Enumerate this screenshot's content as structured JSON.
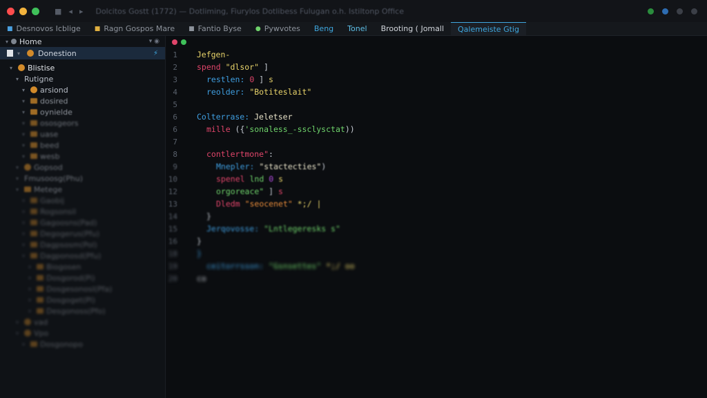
{
  "colors": {
    "accent": "#3fa8e0",
    "folder": "#d18a2a",
    "bg": "#0b0d10"
  },
  "titlebar": {
    "icons": [
      "square-icon",
      "back-icon",
      "forward-icon"
    ],
    "window_title": "Dolcitos Gostt (1772) — Dotliming, Fiurylos Dotlibess Fulugan o.h. Istiltonp Office"
  },
  "tabs": [
    {
      "label": "Desnovos Icblige",
      "icon": "tab-dot-icon"
    },
    {
      "label": "Ragn Gospos Mare",
      "icon": "tab-dot-icon"
    },
    {
      "label": "Fantio Byse",
      "icon": "tab-dot-icon"
    },
    {
      "label": "Pywvotes",
      "icon": "tab-dot-icon"
    },
    {
      "label": "Beng"
    },
    {
      "label": "Tonel"
    },
    {
      "label": "Brooting ( Jomall"
    },
    {
      "label": "Qalemeiste Gtig",
      "active": true
    }
  ],
  "sidebar": {
    "header": "Home",
    "selected": "Donestion",
    "tree": [
      {
        "label": "Blistise",
        "indent": 0,
        "type": "circle",
        "fade": 0
      },
      {
        "label": "Rutigne",
        "indent": 1,
        "type": "none",
        "fade": 0
      },
      {
        "label": "arsiond",
        "indent": 2,
        "type": "circle",
        "fade": 0
      },
      {
        "label": "dosired",
        "indent": 2,
        "type": "folder",
        "fade": 1
      },
      {
        "label": "oynielde",
        "indent": 2,
        "type": "folder",
        "fade": 1
      },
      {
        "label": "ososgeors",
        "indent": 2,
        "type": "folder",
        "fade": 2
      },
      {
        "label": "uase",
        "indent": 2,
        "type": "folder",
        "fade": 2
      },
      {
        "label": "beed",
        "indent": 2,
        "type": "folder",
        "fade": 2
      },
      {
        "label": "wesb",
        "indent": 2,
        "type": "folder",
        "fade": 2
      },
      {
        "label": "Gopsod",
        "indent": 1,
        "type": "circle",
        "fade": 2
      },
      {
        "label": "Fmusoosg(Phu)",
        "indent": 1,
        "type": "none",
        "fade": 2
      },
      {
        "label": "Metege",
        "indent": 1,
        "type": "folder",
        "fade": 2
      },
      {
        "label": "Gaobij",
        "indent": 2,
        "type": "folder",
        "fade": 3
      },
      {
        "label": "Rogsonsil",
        "indent": 2,
        "type": "folder",
        "fade": 3
      },
      {
        "label": "Gagoosns(Pad)",
        "indent": 2,
        "type": "folder",
        "fade": 3
      },
      {
        "label": "Degogerus(Pfu)",
        "indent": 2,
        "type": "folder",
        "fade": 3
      },
      {
        "label": "Dagpsosm(Pol)",
        "indent": 2,
        "type": "folder",
        "fade": 3
      },
      {
        "label": "Dagponosd(Pfu)",
        "indent": 2,
        "type": "folder",
        "fade": 3
      },
      {
        "label": "Biogosen",
        "indent": 3,
        "type": "folder",
        "fade": 3
      },
      {
        "label": "Dosgorod(Pi)",
        "indent": 3,
        "type": "folder",
        "fade": 3
      },
      {
        "label": "Dosgesonosl(Pfa)",
        "indent": 3,
        "type": "folder",
        "fade": 3
      },
      {
        "label": "Dosgoget(Pl)",
        "indent": 3,
        "type": "folder",
        "fade": 3
      },
      {
        "label": "Desgonoss(Pfo)",
        "indent": 3,
        "type": "folder",
        "fade": 3
      },
      {
        "label": "vad",
        "indent": 1,
        "type": "circle",
        "fade": 3
      },
      {
        "label": "Vpo",
        "indent": 1,
        "type": "circle",
        "fade": 3
      },
      {
        "label": "Dosgonopo",
        "indent": 2,
        "type": "folder",
        "fade": 3
      }
    ]
  },
  "code": [
    {
      "n": "1",
      "indent": 0,
      "parts": [
        [
          "p",
          "  "
        ],
        [
          "s",
          "Jefgen-"
        ]
      ]
    },
    {
      "n": "2",
      "indent": 1,
      "parts": [
        [
          "k",
          "spend"
        ],
        [
          "p",
          " "
        ],
        [
          "s",
          "\"dlsor\""
        ],
        [
          "p",
          " ]"
        ]
      ]
    },
    {
      "n": "3",
      "indent": 2,
      "parts": [
        [
          "b",
          "restlen:"
        ],
        [
          "p",
          " "
        ],
        [
          "k",
          "0"
        ],
        [
          "p",
          " ] "
        ],
        [
          "s",
          "s"
        ]
      ]
    },
    {
      "n": "4",
      "indent": 2,
      "parts": [
        [
          "b",
          "reolder:"
        ],
        [
          "p",
          " "
        ],
        [
          "s",
          "\"Botiteslait\""
        ]
      ]
    },
    {
      "n": "5",
      "indent": 0,
      "parts": []
    },
    {
      "n": "6",
      "indent": 1,
      "parts": [
        [
          "b",
          "Colterrase:"
        ],
        [
          "p",
          " "
        ],
        [
          "w",
          "Jeletser"
        ]
      ]
    },
    {
      "n": "6",
      "indent": 2,
      "parts": [
        [
          "k",
          "mille"
        ],
        [
          "p",
          " ({"
        ],
        [
          "v",
          "'sonaless_-ssclysctat"
        ],
        [
          "p",
          "))"
        ]
      ]
    },
    {
      "n": "7",
      "indent": 0,
      "parts": []
    },
    {
      "n": "8",
      "indent": 2,
      "parts": [
        [
          "k",
          "contlertmone\""
        ],
        [
          "p",
          ":"
        ]
      ]
    },
    {
      "n": "9",
      "indent": 3,
      "parts": [
        [
          "b",
          "Mnepler:"
        ],
        [
          "p",
          " "
        ],
        [
          "w",
          "\"stactecties\""
        ],
        [
          "p",
          ")"
        ]
      ]
    },
    {
      "n": "10",
      "indent": 3,
      "parts": [
        [
          "k",
          "spenel"
        ],
        [
          "p",
          " "
        ],
        [
          "v",
          "lnd"
        ],
        [
          "p",
          " "
        ],
        [
          "m",
          "0"
        ],
        [
          "p",
          " "
        ],
        [
          "s",
          "s"
        ]
      ]
    },
    {
      "n": "12",
      "indent": 3,
      "parts": [
        [
          "v",
          "orgoreace\""
        ],
        [
          "p",
          " ] "
        ],
        [
          "k",
          "s"
        ]
      ]
    },
    {
      "n": "13",
      "indent": 3,
      "parts": [
        [
          "k",
          "Dledm"
        ],
        [
          "p",
          " "
        ],
        [
          "o",
          "\"seocenet\""
        ],
        [
          "p",
          " "
        ],
        [
          "s",
          "*;/ |"
        ]
      ]
    },
    {
      "n": "14",
      "indent": 2,
      "parts": [
        [
          "p",
          "}"
        ]
      ]
    },
    {
      "n": "15",
      "indent": 2,
      "parts": [
        [
          "b",
          "Jerqovosse:"
        ],
        [
          "p",
          " "
        ],
        [
          "v",
          "\"Lntlegeresks s\""
        ]
      ]
    },
    {
      "n": "16",
      "indent": 1,
      "parts": [
        [
          "p",
          "}"
        ]
      ]
    },
    {
      "n": "18",
      "indent": 1,
      "parts": [
        [
          "b",
          "}"
        ]
      ]
    },
    {
      "n": "19",
      "indent": 2,
      "parts": [
        [
          "b",
          "ceitorrsson:"
        ],
        [
          "p",
          " "
        ],
        [
          "v",
          "\"Gsnsettes\""
        ],
        [
          "p",
          " "
        ],
        [
          "s",
          "*;/ oo"
        ]
      ]
    },
    {
      "n": "20",
      "indent": 1,
      "parts": [
        [
          "p",
          "co"
        ]
      ]
    }
  ]
}
